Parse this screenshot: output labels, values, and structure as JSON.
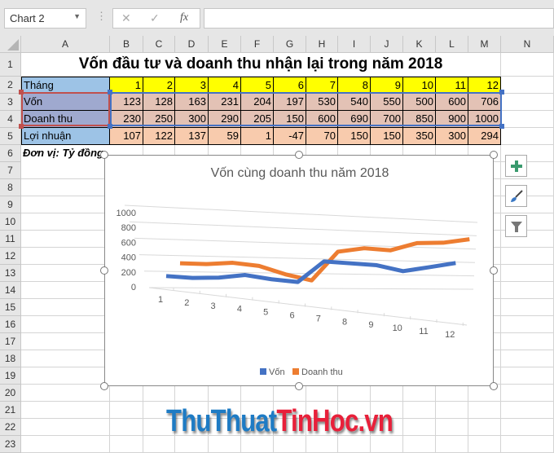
{
  "namebox": {
    "value": "Chart 2"
  },
  "formula_bar": {
    "cancel": "✕",
    "enter": "✓",
    "fx": "fx",
    "value": ""
  },
  "columns": [
    "A",
    "B",
    "C",
    "D",
    "E",
    "F",
    "G",
    "H",
    "I",
    "J",
    "K",
    "L",
    "M",
    "N"
  ],
  "rows": [
    "1",
    "2",
    "3",
    "4",
    "5",
    "6",
    "7",
    "8",
    "9",
    "10",
    "11",
    "12",
    "13",
    "14",
    "15",
    "16",
    "17",
    "18",
    "19",
    "20",
    "21",
    "22",
    "23"
  ],
  "sheet": {
    "title": "Vốn đầu tư và doanh thu nhận lại trong năm 2018",
    "table": [
      {
        "label": "Tháng",
        "values": [
          "1",
          "2",
          "3",
          "4",
          "5",
          "6",
          "7",
          "8",
          "9",
          "10",
          "11",
          "12"
        ]
      },
      {
        "label": "Vốn",
        "values": [
          "123",
          "128",
          "163",
          "231",
          "204",
          "197",
          "530",
          "540",
          "550",
          "500",
          "600",
          "706"
        ]
      },
      {
        "label": "Doanh thu",
        "values": [
          "230",
          "250",
          "300",
          "290",
          "205",
          "150",
          "600",
          "690",
          "700",
          "850",
          "900",
          "1000"
        ]
      },
      {
        "label": "Lợi nhuận",
        "values": [
          "107",
          "122",
          "137",
          "59",
          "1",
          "-47",
          "70",
          "150",
          "150",
          "350",
          "300",
          "294"
        ]
      }
    ],
    "unit_note": "Đơn vị: Tỷ đồng"
  },
  "colors": {
    "header_yellow": "#ffff00",
    "label_blue": "#9dc3e6",
    "label_selected": "#9fa9cf",
    "data_peach": "#f8cbad",
    "data_selected": "#e3c2b5",
    "series_von": "#4472c4",
    "series_doanhthu": "#ed7d31",
    "watermark_blue": "#1e7bc4",
    "watermark_red": "#e8203a"
  },
  "chart_data": {
    "type": "line",
    "subtype": "3d-line",
    "title": "Vốn cùng doanh thu năm 2018",
    "categories": [
      "1",
      "2",
      "3",
      "4",
      "5",
      "6",
      "7",
      "8",
      "9",
      "10",
      "11",
      "12"
    ],
    "y_ticks": [
      "0",
      "200",
      "400",
      "600",
      "800",
      "1000"
    ],
    "ylim": [
      0,
      1000
    ],
    "grid": true,
    "legend": "bottom",
    "series": [
      {
        "name": "Vốn",
        "values": [
          123,
          128,
          163,
          231,
          204,
          197,
          530,
          540,
          550,
          500,
          600,
          706
        ]
      },
      {
        "name": "Doanh thu",
        "values": [
          230,
          250,
          300,
          290,
          205,
          150,
          600,
          690,
          700,
          850,
          900,
          1000
        ]
      }
    ]
  },
  "side_buttons": [
    {
      "icon": "plus-icon"
    },
    {
      "icon": "paintbrush-icon"
    },
    {
      "icon": "filter-icon"
    }
  ],
  "watermark": {
    "part1": "ThuThuat",
    "part2": "TinHoc.vn"
  }
}
